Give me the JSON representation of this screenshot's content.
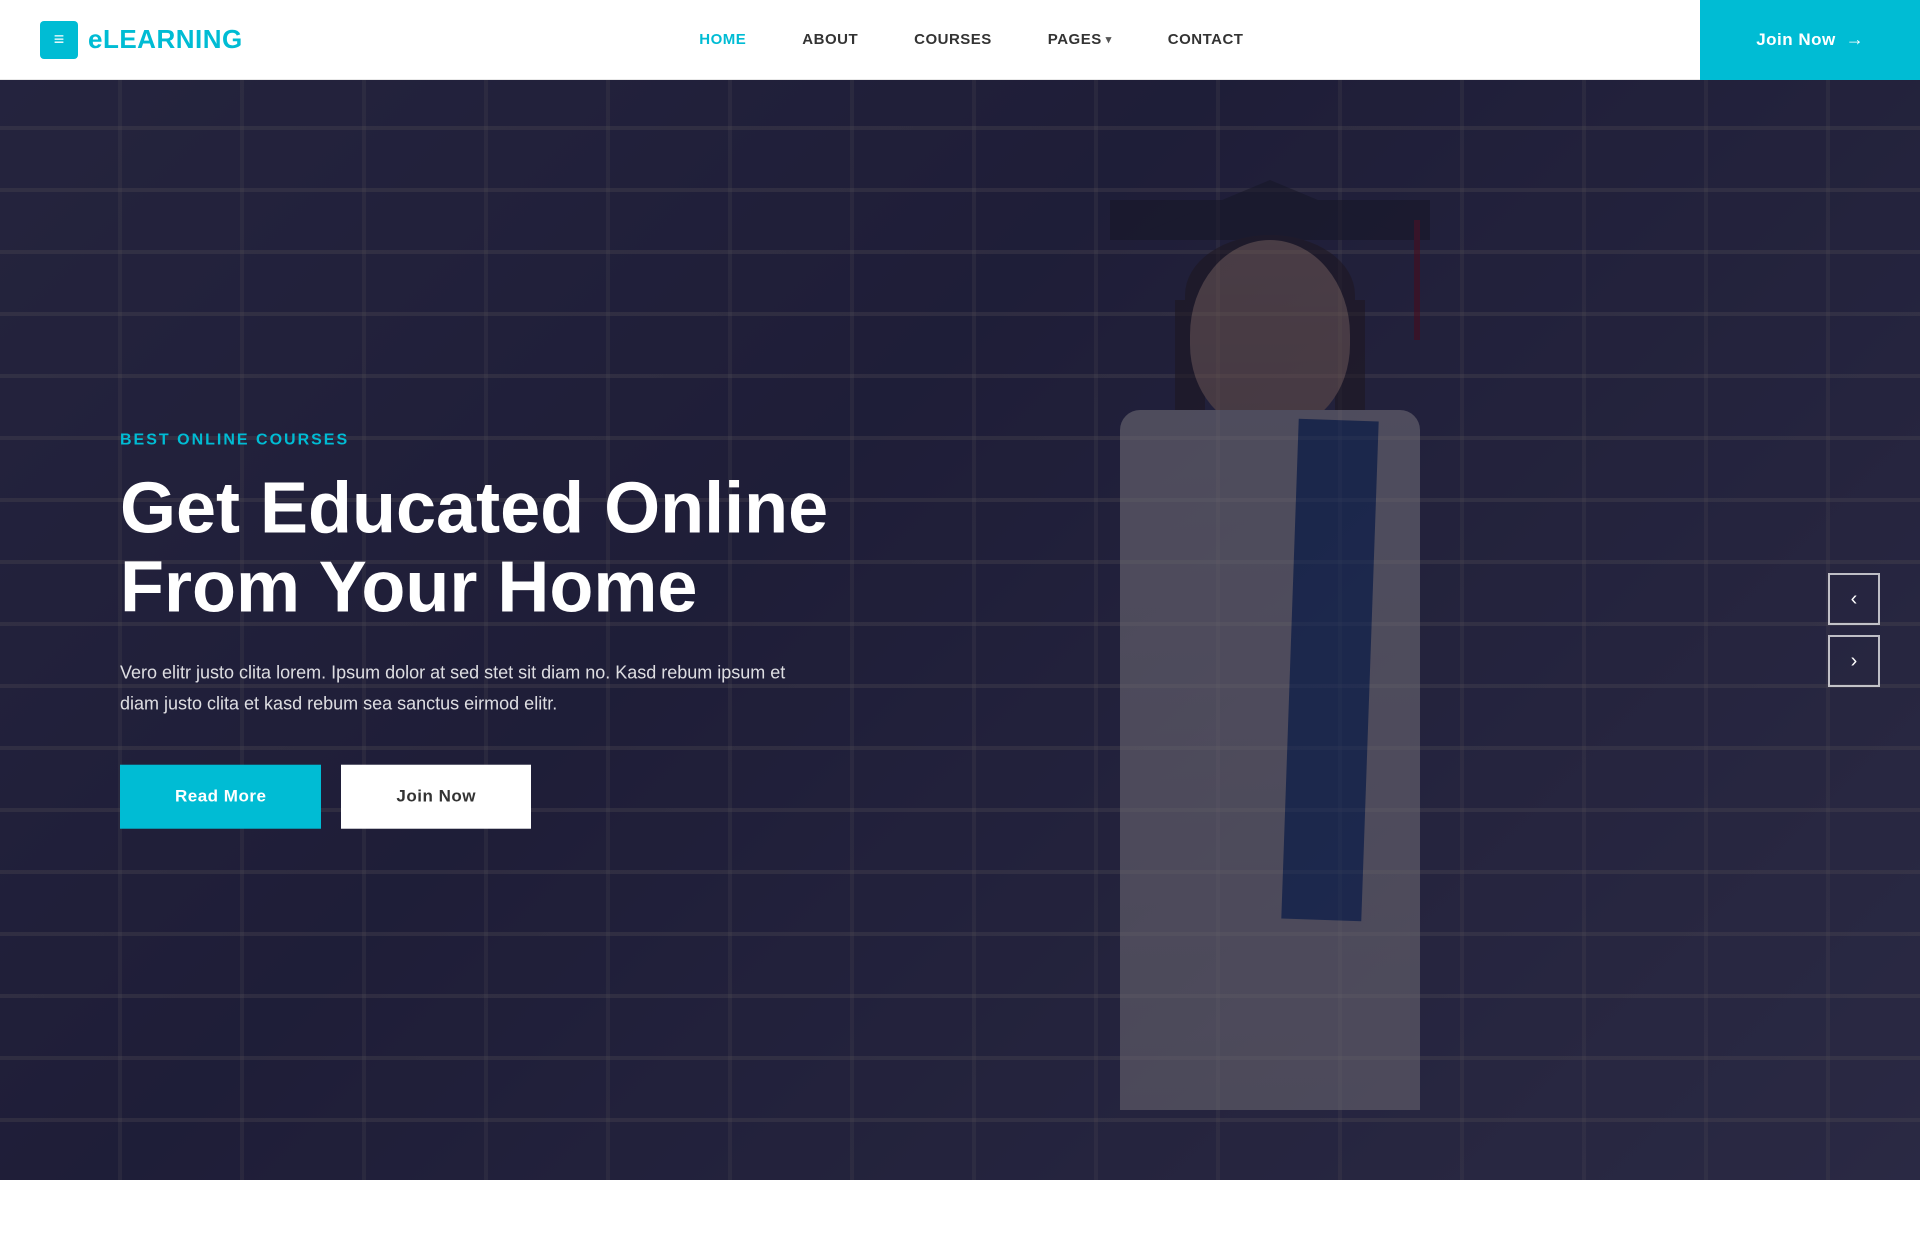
{
  "brand": {
    "icon": "≡",
    "name": "eLEARNING"
  },
  "navbar": {
    "links": [
      {
        "label": "HOME",
        "active": true
      },
      {
        "label": "ABOUT",
        "active": false
      },
      {
        "label": "COURSES",
        "active": false
      },
      {
        "label": "PAGES",
        "active": false,
        "hasDropdown": true
      },
      {
        "label": "CONTACT",
        "active": false
      }
    ],
    "join_label": "Join Now",
    "join_arrow": "→"
  },
  "hero": {
    "subtitle": "BEST ONLINE COURSES",
    "title_line1": "Get Educated Online",
    "title_line2": "From Your Home",
    "description": "Vero elitr justo clita lorem. Ipsum dolor at sed stet sit diam no. Kasd rebum ipsum et diam justo clita et kasd rebum sea sanctus eirmod elitr.",
    "btn_read_more": "Read More",
    "btn_join_now": "Join Now"
  },
  "slider": {
    "prev_arrow": "‹",
    "next_arrow": "›"
  }
}
